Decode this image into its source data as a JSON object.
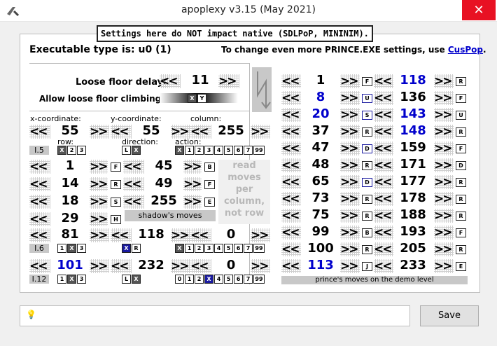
{
  "window": {
    "title": "apoplexy v3.15 (May 2021)",
    "close": "✕"
  },
  "notice": "Settings here do NOT impact native (SDLPoP, MININIM).",
  "exe": {
    "label": "Executable type is: u0 (1)"
  },
  "cuspop": {
    "prefix": "To change even more PRINCE.EXE settings, use ",
    "link": "CusPop",
    "suffix": "."
  },
  "loose": {
    "delay_label": "Loose floor delay:",
    "delay_value": "11",
    "climb_label": "Allow loose floor climbing:",
    "climb_options": [
      "X",
      "Y"
    ]
  },
  "coords": {
    "x_label": "x-coordinate:",
    "y_label": "y-coordinate:",
    "col_label": "column:",
    "row_label": "row:",
    "dir_label": "direction:",
    "act_label": "action:",
    "left_btn": "<<",
    "right_btn": ">>"
  },
  "blocks": [
    {
      "tag": "I.5",
      "x": "55",
      "y": "55",
      "col": "255",
      "rows": [
        "X",
        "2",
        "3"
      ],
      "dir": [
        "L",
        "X"
      ],
      "act": [
        "X",
        "1",
        "2",
        "3",
        "4",
        "5",
        "6",
        "7",
        "99"
      ]
    },
    {
      "tag": "I.6",
      "x": "81",
      "y": "118",
      "col": "0",
      "rows": [
        "1",
        "X",
        "3"
      ],
      "dir": [
        "X",
        "R"
      ],
      "act": [
        "X",
        "1",
        "2",
        "3",
        "4",
        "5",
        "6",
        "7",
        "99"
      ]
    },
    {
      "tag": "I.12",
      "x": "101",
      "y": "232",
      "col": "0",
      "rows": [
        "1",
        "X",
        "3"
      ],
      "dir": [
        "L",
        "X"
      ],
      "act": [
        "0",
        "1",
        "2",
        "X",
        "4",
        "5",
        "6",
        "7",
        "99"
      ]
    }
  ],
  "shadow_moves": [
    {
      "a": "1",
      "ak": "F",
      "b": "45",
      "bk": "B"
    },
    {
      "a": "14",
      "ak": "R",
      "b": "49",
      "bk": "F"
    },
    {
      "a": "18",
      "ak": "S",
      "b": "255",
      "bk": "E"
    },
    {
      "a": "29",
      "ak": "H"
    }
  ],
  "shadow_label": "shadow's moves",
  "read_note": "read moves per column, not row",
  "prince_moves": [
    {
      "a": "1",
      "ak": "F",
      "b": "118",
      "bk": "R",
      "ab": false,
      "bb": true
    },
    {
      "a": "8",
      "ak": "U",
      "b": "136",
      "bk": "F",
      "ab": true,
      "bb": false
    },
    {
      "a": "20",
      "ak": "S",
      "b": "143",
      "bk": "U",
      "ab": true,
      "bb": true
    },
    {
      "a": "37",
      "ak": "R",
      "b": "148",
      "bk": "R",
      "ab": false,
      "bb": true
    },
    {
      "a": "47",
      "ak": "D",
      "b": "159",
      "bk": "F",
      "ab": false,
      "bb": false
    },
    {
      "a": "48",
      "ak": "R",
      "b": "171",
      "bk": "D",
      "ab": false,
      "bb": false
    },
    {
      "a": "65",
      "ak": "D",
      "b": "177",
      "bk": "R",
      "ab": false,
      "bb": false
    },
    {
      "a": "73",
      "ak": "R",
      "b": "178",
      "bk": "R",
      "ab": false,
      "bb": false
    },
    {
      "a": "75",
      "ak": "R",
      "b": "188",
      "bk": "R",
      "ab": false,
      "bb": false
    },
    {
      "a": "99",
      "ak": "B",
      "b": "193",
      "bk": "F",
      "ab": false,
      "bb": false
    },
    {
      "a": "100",
      "ak": "R",
      "b": "205",
      "bk": "R",
      "ab": false,
      "bb": false
    },
    {
      "a": "113",
      "ak": "J",
      "b": "233",
      "bk": "E",
      "ab": true,
      "bb": false
    }
  ],
  "prince_label": "prince's moves on the demo level",
  "save": "Save",
  "status_icon": "lightbulb-icon"
}
